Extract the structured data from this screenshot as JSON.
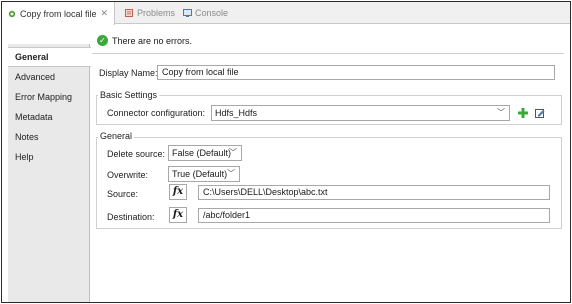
{
  "tabs": [
    {
      "label": "Copy from local file",
      "active": true
    },
    {
      "label": "Problems",
      "active": false
    },
    {
      "label": "Console",
      "active": false
    }
  ],
  "nav": {
    "items": [
      {
        "label": "General",
        "selected": true
      },
      {
        "label": "Advanced"
      },
      {
        "label": "Error Mapping"
      },
      {
        "label": "Metadata"
      },
      {
        "label": "Notes"
      },
      {
        "label": "Help"
      }
    ]
  },
  "status": {
    "message": "There are no errors."
  },
  "form": {
    "display_name": {
      "label": "Display Name:",
      "value": "Copy from local file"
    },
    "basic_settings": {
      "title": "Basic Settings",
      "connector_label": "Connector configuration:",
      "connector_value": "Hdfs_Hdfs"
    },
    "general": {
      "title": "General",
      "delete_source_label": "Delete source:",
      "delete_source_value": "False (Default)",
      "overwrite_label": "Overwrite:",
      "overwrite_value": "True (Default)",
      "source_label": "Source:",
      "source_value": "C:\\Users\\DELL\\Desktop\\abc.txt",
      "destination_label": "Destination:",
      "destination_value": "/abc/folder1",
      "fx_label": "fx"
    }
  },
  "icons": {
    "tab_icon": "flow-icon",
    "add_icon": "add-icon",
    "edit_icon": "edit-icon"
  },
  "colors": {
    "status_ok": "#3aa83a",
    "add_green": "#3aa83a"
  }
}
